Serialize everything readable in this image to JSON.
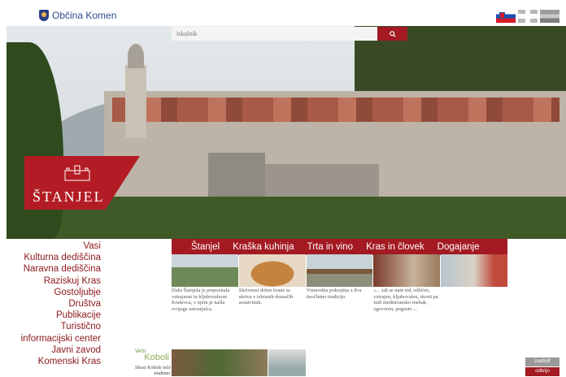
{
  "header": {
    "logo_text": "Občina Komen",
    "flags": [
      "flag-si-icon",
      "flag-gb-icon",
      "flag-de-icon"
    ]
  },
  "search": {
    "placeholder": "iskalnik",
    "button_icon": "search-icon"
  },
  "hero": {
    "banner_title": "ŠTANJEL",
    "banner_icon": "castle-icon"
  },
  "sidebar": {
    "items": [
      "Vasi",
      "Kulturna dediščina",
      "Naravna dediščina",
      "Raziskuj Kras",
      "Gostoljubje",
      "Društva",
      "Publikacije",
      "Turistično",
      "informacijski center",
      "Javni zavod",
      "Komenski Kras"
    ]
  },
  "tabs": [
    "Štanjel",
    "Kraška kuhinja",
    "Trta in vino",
    "Kras in človek",
    "Dogajanje"
  ],
  "cards": [
    {
      "caption": "Duša Štanjela je prepoznala vztrajnost in kljubovalnost Kraševca, v njem je našla svojega ustvarjalca."
    },
    {
      "caption": "Skrivnost dobre hrane se skriva v izbranih domačih sestavinah."
    },
    {
      "caption": "Vinorodna pokrajina z dva tisočletno tradicijo."
    },
    {
      "caption": "»... zdi se nam trd, odličen, vztrajen, kljubovalen, skroti pa tudi mediteransko mehak, zgovoren, pogosto ..."
    },
    {
      "caption": ""
    }
  ],
  "village": {
    "label": "VASI",
    "name": "Koboli",
    "text": "Skozi Kobole teče studenec"
  },
  "buttons": {
    "gray": "zaobolf",
    "red": "odkrijo"
  },
  "colors": {
    "accent": "#a31a22",
    "sidebar_text": "#8e1a20"
  }
}
